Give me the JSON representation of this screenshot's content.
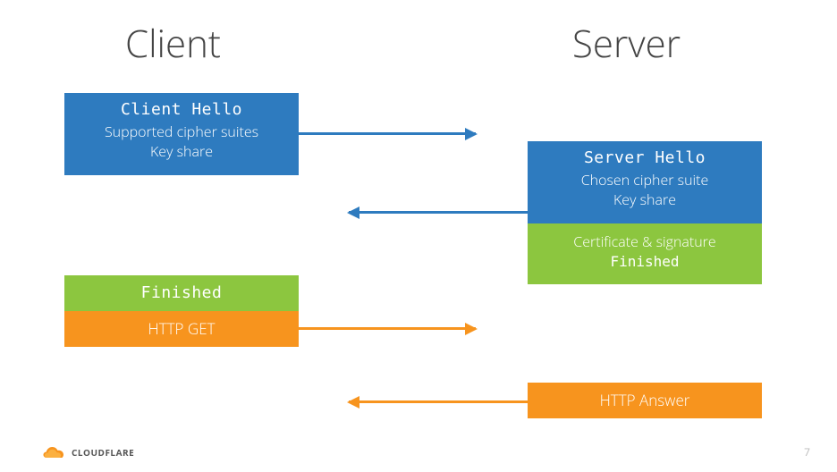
{
  "headings": {
    "client": "Client",
    "server": "Server"
  },
  "client": {
    "hello": {
      "title": "Client Hello",
      "l1": "Supported cipher suites",
      "l2": "Key share"
    },
    "finished": {
      "title": "Finished"
    },
    "httpget": {
      "title": "HTTP GET"
    }
  },
  "server": {
    "hello": {
      "title": "Server Hello",
      "l1": "Chosen cipher suite",
      "l2": "Key share"
    },
    "cert": {
      "l1": "Certificate & signature",
      "l2": "Finished"
    },
    "answer": {
      "title": "HTTP Answer"
    }
  },
  "footer": {
    "brand": "CloudFlare",
    "page": "7"
  },
  "colors": {
    "blue": "#2e7bbf",
    "green": "#8cc63f",
    "orange": "#f7941e"
  }
}
